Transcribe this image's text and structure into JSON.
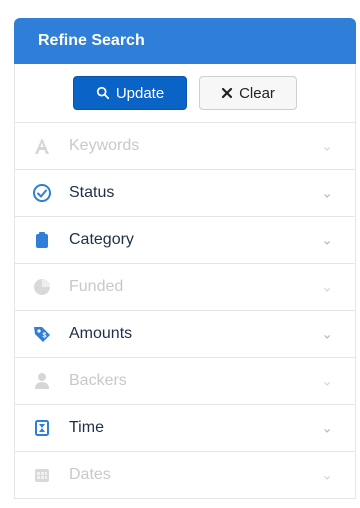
{
  "panel": {
    "title": "Refine Search",
    "buttons": {
      "update_label": "Update",
      "clear_label": "Clear"
    }
  },
  "filters": [
    {
      "label": "Keywords",
      "enabled": false,
      "icon": "letter-a-icon"
    },
    {
      "label": "Status",
      "enabled": true,
      "icon": "checkmark-circle-icon"
    },
    {
      "label": "Category",
      "enabled": true,
      "icon": "clipboard-icon"
    },
    {
      "label": "Funded",
      "enabled": false,
      "icon": "pie-icon"
    },
    {
      "label": "Amounts",
      "enabled": true,
      "icon": "tag-icon"
    },
    {
      "label": "Backers",
      "enabled": false,
      "icon": "person-icon"
    },
    {
      "label": "Time",
      "enabled": true,
      "icon": "hourglass-icon"
    },
    {
      "label": "Dates",
      "enabled": false,
      "icon": "calendar-icon"
    }
  ],
  "colors": {
    "header_bg": "#2f7ed8",
    "primary_button": "#0a63c7",
    "enabled_icon": "#2f7ed8",
    "disabled_text": "#c9c9c9"
  }
}
